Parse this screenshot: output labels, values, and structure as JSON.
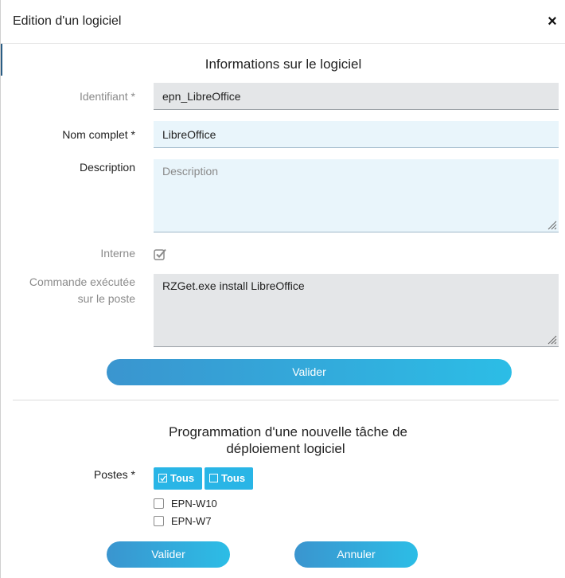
{
  "dialog": {
    "title": "Edition d'un logiciel",
    "close_glyph": "×"
  },
  "software_info": {
    "section_title": "Informations sur le logiciel",
    "identifiant": {
      "label": "Identifiant *",
      "value": "epn_LibreOffice"
    },
    "nom_complet": {
      "label": "Nom complet *",
      "value": "LibreOffice"
    },
    "description": {
      "label": "Description",
      "value": "",
      "placeholder": "Description"
    },
    "interne": {
      "label": "Interne",
      "checked": true
    },
    "commande": {
      "label_line1": "Commande exécutée",
      "label_line2": "sur le poste",
      "value": "RZGet.exe install LibreOffice"
    },
    "submit_label": "Valider"
  },
  "deployment": {
    "section_title_line1": "Programmation d'une nouvelle tâche de",
    "section_title_line2": "déploiement logiciel",
    "postes_label": "Postes *",
    "select_all_label": "Tous",
    "deselect_all_label": "Tous",
    "postes": [
      {
        "name": "EPN-W10",
        "checked": false
      },
      {
        "name": "EPN-W7",
        "checked": false
      }
    ],
    "submit_label": "Valider",
    "cancel_label": "Annuler"
  },
  "colors": {
    "button_gradient_start": "#3a95cf",
    "button_gradient_end": "#2cbde6",
    "toggle_button": "#29b5e6",
    "readonly_field": "#e4e6e8",
    "editable_field": "#e9f5fb"
  }
}
